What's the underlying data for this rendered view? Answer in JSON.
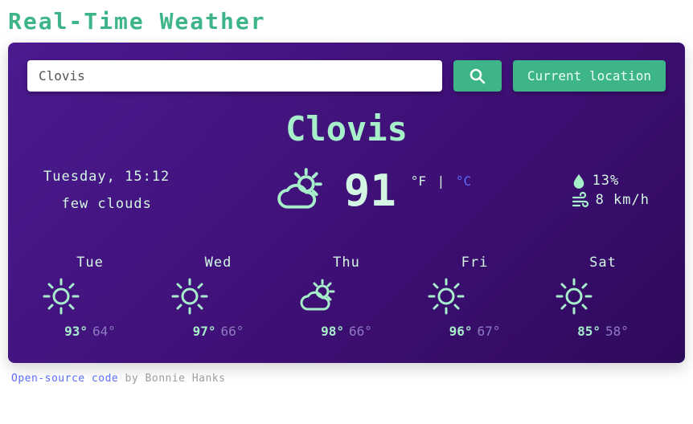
{
  "page_title": "Real-Time Weather",
  "search": {
    "value": "Clovis",
    "current_location_label": "Current location"
  },
  "city": "Clovis",
  "current": {
    "datetime": "Tuesday, 15:12",
    "description": "few clouds",
    "temp": "91",
    "unit_f": "°F",
    "unit_sep": "|",
    "unit_c": "°C",
    "humidity": "13%",
    "wind": "8 km/h"
  },
  "forecast": [
    {
      "name": "Tue",
      "icon": "sun",
      "hi": "93°",
      "lo": "64°"
    },
    {
      "name": "Wed",
      "icon": "sun",
      "hi": "97°",
      "lo": "66°"
    },
    {
      "name": "Thu",
      "icon": "sun-cloud",
      "hi": "98°",
      "lo": "66°"
    },
    {
      "name": "Fri",
      "icon": "sun",
      "hi": "96°",
      "lo": "67°"
    },
    {
      "name": "Sat",
      "icon": "sun",
      "hi": "85°",
      "lo": "58°"
    }
  ],
  "footer": {
    "link": "Open-source code",
    "by": " by Bonnie Hanks"
  }
}
